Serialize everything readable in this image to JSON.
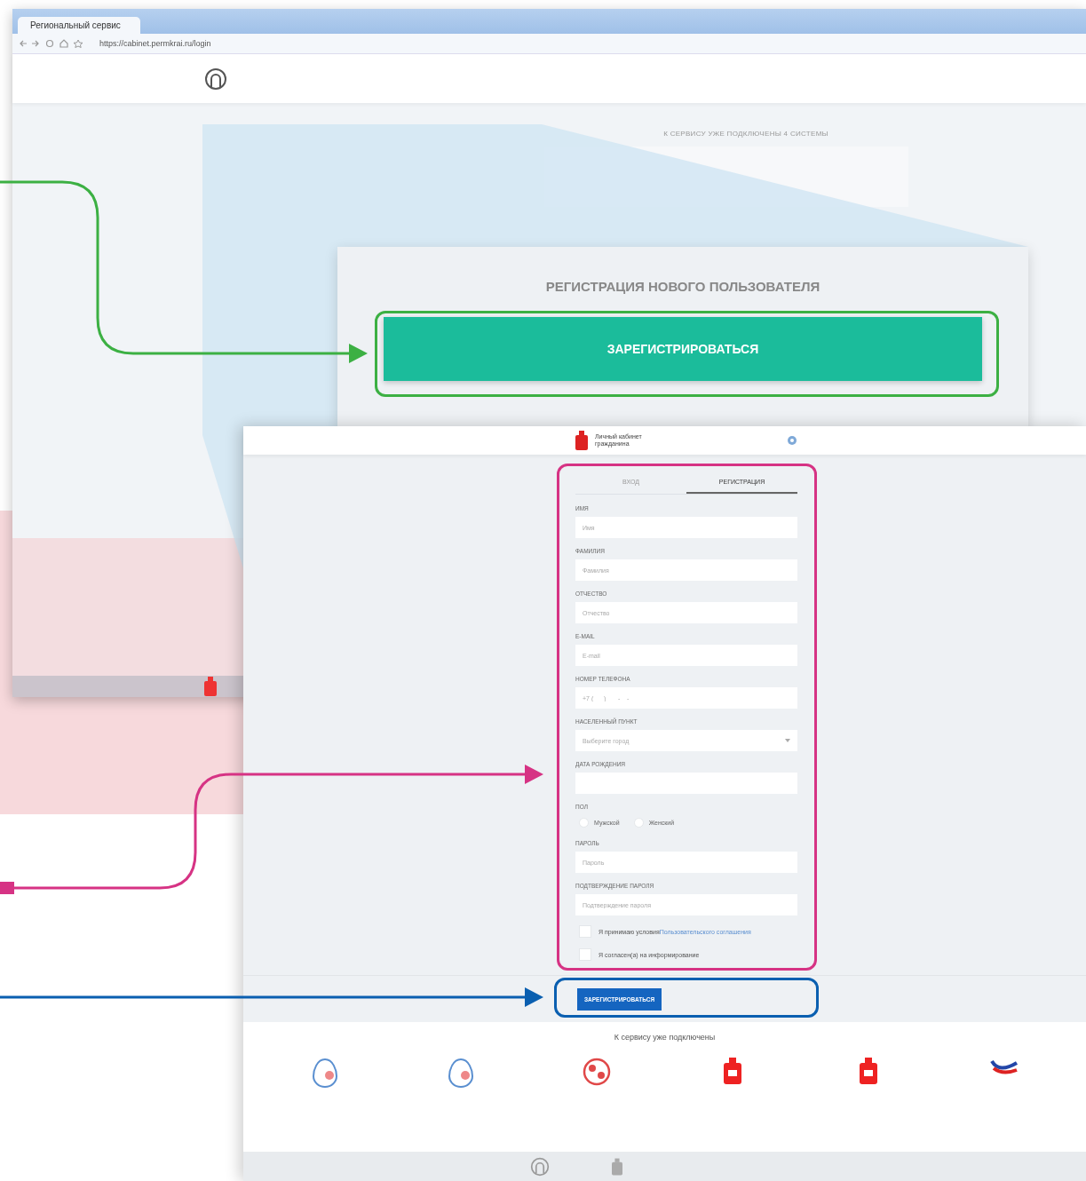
{
  "browser": {
    "tab_title": "Региональный сервис",
    "url": "https://cabinet.permkrai.ru/login"
  },
  "back_page": {
    "notice": "К СЕРВИСУ УЖЕ ПОДКЛЮЧЕНЫ 4 СИСТЕМЫ"
  },
  "zoom_panel": {
    "title": "РЕГИСТРАЦИЯ НОВОГО ПОЛЬЗОВАТЕЛЯ",
    "button": "ЗАРЕГИСТРИРОВАТЬСЯ"
  },
  "front_page": {
    "brand": "Личный кабинет гражданина",
    "tabs": [
      {
        "label": "ВХОД",
        "selected": false
      },
      {
        "label": "РЕГИСТРАЦИЯ",
        "selected": true
      }
    ],
    "fields": [
      {
        "kind": "text",
        "label": "ИМЯ",
        "placeholder": "Имя"
      },
      {
        "kind": "text",
        "label": "ФАМИЛИЯ",
        "placeholder": "Фамилия"
      },
      {
        "kind": "text",
        "label": "ОТЧЕСТВО",
        "placeholder": "Отчество"
      },
      {
        "kind": "text",
        "label": "E-MAIL",
        "placeholder": "E-mail"
      },
      {
        "kind": "text",
        "label": "НОМЕР ТЕЛЕФОНА",
        "placeholder": "+7 (___) ___-__-__"
      },
      {
        "kind": "select",
        "label": "НАСЕЛЕННЫЙ ПУНКТ",
        "placeholder": "Выберите город"
      },
      {
        "kind": "text",
        "label": "ДАТА РОЖДЕНИЯ"
      },
      {
        "kind": "radio",
        "label": "ПОЛ",
        "options": [
          {
            "label": "Мужской",
            "selected": false
          },
          {
            "label": "Женский",
            "selected": false
          }
        ]
      },
      {
        "kind": "text",
        "label": "ПАРОЛЬ",
        "placeholder": "Пароль"
      },
      {
        "kind": "text",
        "label": "ПОДТВЕРЖДЕНИЕ ПАРОЛЯ",
        "placeholder": "Подтверждение пароля"
      }
    ],
    "agreements": [
      {
        "text": "Я принимаю условия",
        "link": "Пользовательского соглашения",
        "checked": false
      },
      {
        "text": "Я согласен(а) на информирование",
        "checked": false
      }
    ],
    "submit": "ЗАРЕГИСТРИРОВАТЬСЯ",
    "services_title": "К сервису уже подключены",
    "services": [
      {
        "kind": "egg"
      },
      {
        "kind": "egg"
      },
      {
        "kind": "ball"
      },
      {
        "kind": "crest"
      },
      {
        "kind": "crest"
      },
      {
        "kind": "stripes"
      }
    ]
  },
  "callouts": [
    {
      "color": "#3cb043"
    },
    {
      "color": "#d63384"
    },
    {
      "color": "#0a5fb0"
    }
  ]
}
